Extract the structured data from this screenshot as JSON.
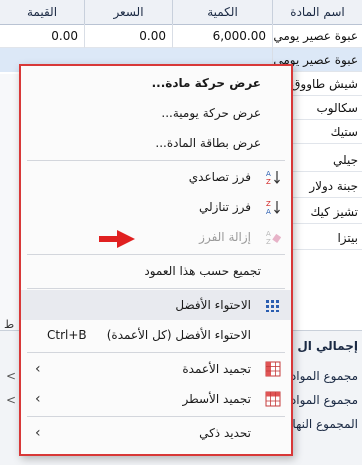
{
  "grid": {
    "columns": {
      "name": "اسم المادة",
      "qty": "الكمية",
      "price": "السعر",
      "value": "القيمة"
    },
    "rows": [
      {
        "name": "عبوة عصير يومي مناسب",
        "qty": "6,000.00",
        "price": "0.00",
        "value": "0.00"
      },
      {
        "name": "عبوة عصير يومي",
        "qty": "",
        "price": "",
        "value": ""
      },
      {
        "name": "شيش طاووق",
        "qty": "",
        "price": "",
        "value": ""
      },
      {
        "name": "سكالوب",
        "qty": "",
        "price": "",
        "value": ""
      },
      {
        "name": "ستيك",
        "qty": "",
        "price": "",
        "value": ""
      },
      {
        "name": "جيلي",
        "qty": "",
        "price": "",
        "value": ""
      },
      {
        "name": "جبنة دولار",
        "qty": "",
        "price": "",
        "value": ""
      },
      {
        "name": "تشيز كيك",
        "qty": "",
        "price": "",
        "value": ""
      },
      {
        "name": "بيتزا",
        "qty": "",
        "price": "",
        "value": ""
      }
    ]
  },
  "side_label": "ط",
  "bottom_panel": {
    "title": "إجمالي ال",
    "rows": [
      "مجموع المواد",
      "مجموع المواد",
      "المجموع النها"
    ]
  },
  "menu": {
    "items": [
      {
        "label": "عرض حركة مادة...",
        "bold": true
      },
      {
        "label": "عرض حركة يومية..."
      },
      {
        "label": "عرض بطاقة المادة..."
      },
      {
        "label": "فرز تصاعدي",
        "icon": "sort-ascending-icon"
      },
      {
        "label": "فرز تنازلي",
        "icon": "sort-descending-icon"
      },
      {
        "label": "إزالة الفرز",
        "icon": "clear-sort-icon",
        "disabled": true
      },
      {
        "label": "تجميع حسب هذا العمود"
      },
      {
        "label": "الاحتواء الأفضل",
        "icon": "best-fit-icon"
      },
      {
        "label": "الاحتواء الأفضل (كل الأعمدة)",
        "shortcut": "Ctrl+B"
      },
      {
        "label": "تجميد الأعمدة",
        "icon": "freeze-columns-icon",
        "submenu": "‹"
      },
      {
        "label": "تجميد الأسطر",
        "icon": "freeze-rows-icon",
        "submenu": "‹"
      },
      {
        "label": "تحديد ذكي",
        "submenu": "‹"
      }
    ]
  },
  "colors": {
    "annotation": "#e02020",
    "menu_border": "#d83838"
  }
}
